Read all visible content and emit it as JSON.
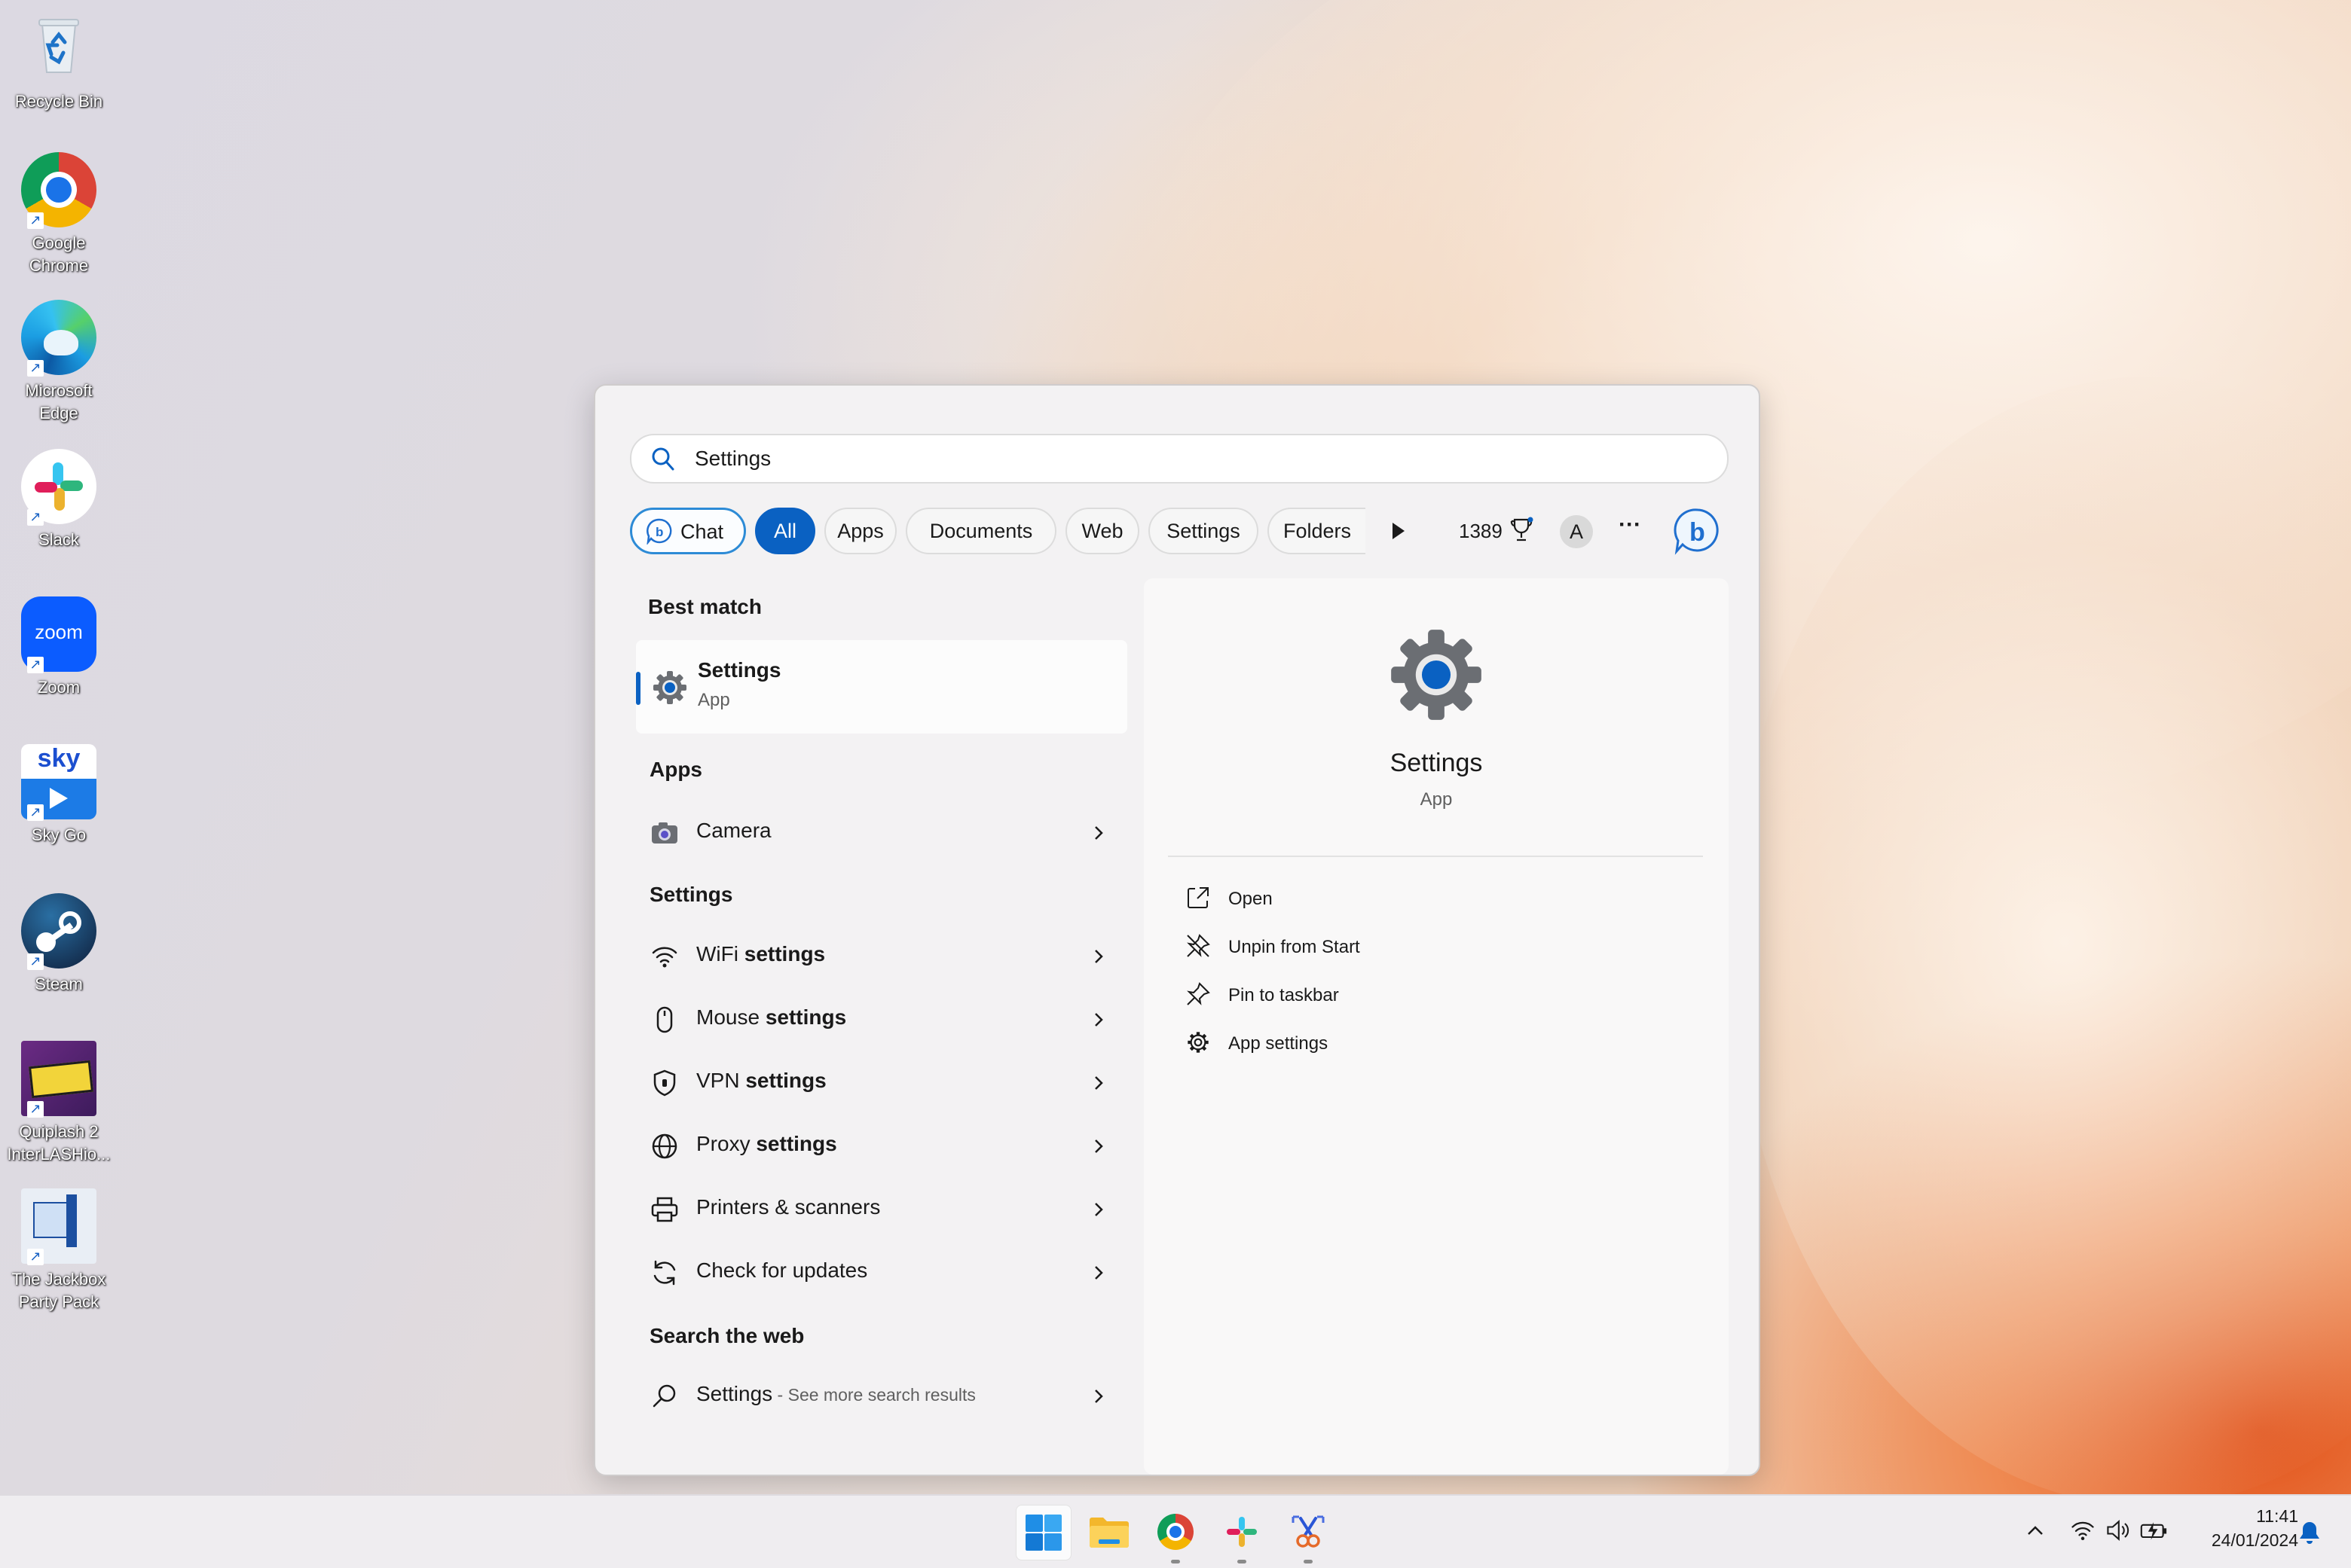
{
  "desktop": {
    "icons": [
      {
        "label": "Recycle Bin"
      },
      {
        "label": "Google Chrome"
      },
      {
        "label": "Microsoft Edge"
      },
      {
        "label": "Slack"
      },
      {
        "label": "Zoom"
      },
      {
        "label": "Sky Go"
      },
      {
        "label": "Steam"
      },
      {
        "label": "Quiplash 2 InterLASHio..."
      },
      {
        "label": "The Jackbox Party Pack"
      }
    ],
    "zoom_tile_text": "zoom",
    "sky_tile_text": "sky"
  },
  "search": {
    "query": "Settings",
    "placeholder": "Settings",
    "filters": [
      {
        "label": "Chat"
      },
      {
        "label": "All"
      },
      {
        "label": "Apps"
      },
      {
        "label": "Documents"
      },
      {
        "label": "Web"
      },
      {
        "label": "Settings"
      },
      {
        "label": "Folders"
      }
    ],
    "points": "1389",
    "avatar_initial": "A",
    "more_label": "···"
  },
  "results": {
    "best_match_header": "Best match",
    "best_match": {
      "title": "Settings",
      "subtitle": "App"
    },
    "apps_header": "Apps",
    "apps": [
      {
        "label": "Camera"
      }
    ],
    "settings_header": "Settings",
    "settings": [
      {
        "pre": "WiFi ",
        "bold": "settings"
      },
      {
        "pre": "Mouse ",
        "bold": "settings"
      },
      {
        "pre": "VPN ",
        "bold": "settings"
      },
      {
        "pre": "Proxy ",
        "bold": "settings"
      },
      {
        "pre": "Printers & scanners",
        "bold": ""
      },
      {
        "pre": "Check for updates",
        "bold": ""
      }
    ],
    "web_header": "Search the web",
    "web": {
      "title": "Settings",
      "suffix": " - See more search results"
    }
  },
  "preview": {
    "title": "Settings",
    "subtitle": "App",
    "actions": [
      {
        "label": "Open"
      },
      {
        "label": "Unpin from Start"
      },
      {
        "label": "Pin to taskbar"
      },
      {
        "label": "App settings"
      }
    ]
  },
  "taskbar": {
    "time": "11:41",
    "date": "24/01/2024"
  },
  "colors": {
    "accent": "#0a61c2",
    "settings_gear": "#6b6e73",
    "settings_core": "#0a61c2"
  }
}
